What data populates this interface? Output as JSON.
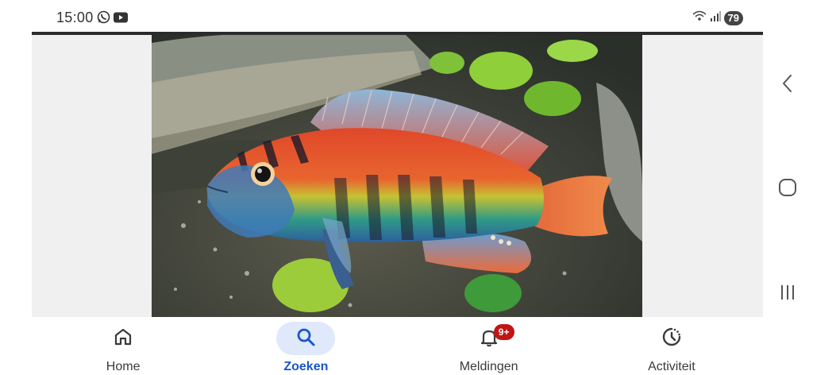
{
  "status_bar": {
    "time": "15:00",
    "left_icons": [
      "whatsapp-icon",
      "youtube-icon"
    ],
    "right_icons": [
      "wifi-icon",
      "signal-icon"
    ],
    "battery": "79"
  },
  "content": {
    "image_subject": "colorful cichlid fish photo"
  },
  "bottom_nav": {
    "items": [
      {
        "label": "Home",
        "icon": "home-icon",
        "active": false
      },
      {
        "label": "Zoeken",
        "icon": "search-icon",
        "active": true
      },
      {
        "label": "Meldingen",
        "icon": "bell-icon",
        "active": false,
        "badge": "9+"
      },
      {
        "label": "Activiteit",
        "icon": "activity-icon",
        "active": false
      }
    ]
  },
  "system_nav": [
    "back-icon",
    "home-circle-icon",
    "recents-icon"
  ],
  "colors": {
    "active_tab_text": "#1a56c9",
    "active_tab_pill": "#dfe9fb",
    "badge": "#c11515"
  }
}
